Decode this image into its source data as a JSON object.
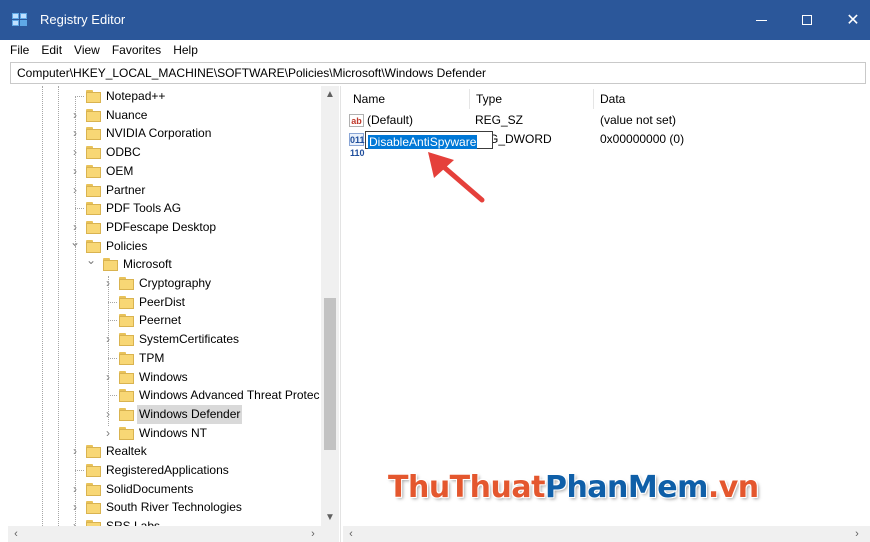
{
  "window": {
    "title": "Registry Editor",
    "colors": {
      "titlebar": "#2b579a",
      "selection": "#0078d7",
      "folder": "#f8d775"
    }
  },
  "menu": [
    "File",
    "Edit",
    "View",
    "Favorites",
    "Help"
  ],
  "address": "Computer\\HKEY_LOCAL_MACHINE\\SOFTWARE\\Policies\\Microsoft\\Windows Defender",
  "tree": [
    {
      "label": "Notepad++",
      "level": 0,
      "chevron": "none"
    },
    {
      "label": "Nuance",
      "level": 0,
      "chevron": "collapsed"
    },
    {
      "label": "NVIDIA Corporation",
      "level": 0,
      "chevron": "collapsed"
    },
    {
      "label": "ODBC",
      "level": 0,
      "chevron": "collapsed"
    },
    {
      "label": "OEM",
      "level": 0,
      "chevron": "collapsed"
    },
    {
      "label": "Partner",
      "level": 0,
      "chevron": "collapsed"
    },
    {
      "label": "PDF Tools AG",
      "level": 0,
      "chevron": "none"
    },
    {
      "label": "PDFescape Desktop",
      "level": 0,
      "chevron": "collapsed"
    },
    {
      "label": "Policies",
      "level": 0,
      "chevron": "expanded"
    },
    {
      "label": "Microsoft",
      "level": 1,
      "chevron": "expanded"
    },
    {
      "label": "Cryptography",
      "level": 2,
      "chevron": "collapsed"
    },
    {
      "label": "PeerDist",
      "level": 2,
      "chevron": "none"
    },
    {
      "label": "Peernet",
      "level": 2,
      "chevron": "none"
    },
    {
      "label": "SystemCertificates",
      "level": 2,
      "chevron": "collapsed"
    },
    {
      "label": "TPM",
      "level": 2,
      "chevron": "none"
    },
    {
      "label": "Windows",
      "level": 2,
      "chevron": "collapsed"
    },
    {
      "label": "Windows Advanced Threat Protec",
      "level": 2,
      "chevron": "none"
    },
    {
      "label": "Windows Defender",
      "level": 2,
      "chevron": "collapsed",
      "selected": true
    },
    {
      "label": "Windows NT",
      "level": 2,
      "chevron": "collapsed"
    },
    {
      "label": "Realtek",
      "level": 0,
      "chevron": "collapsed"
    },
    {
      "label": "RegisteredApplications",
      "level": 0,
      "chevron": "none"
    },
    {
      "label": "SolidDocuments",
      "level": 0,
      "chevron": "collapsed"
    },
    {
      "label": "South River Technologies",
      "level": 0,
      "chevron": "collapsed"
    },
    {
      "label": "SRS Labs",
      "level": 0,
      "chevron": "collapsed"
    }
  ],
  "columns": {
    "name": "Name",
    "type": "Type",
    "data": "Data"
  },
  "values": [
    {
      "icon": "string-value-icon",
      "name": "(Default)",
      "type": "REG_SZ",
      "data": "(value not set)"
    },
    {
      "icon": "dword-value-icon",
      "name": "DisableAntiSpyware",
      "type": "G_DWORD",
      "data": "0x00000000 (0)",
      "editing": true
    }
  ],
  "watermark": {
    "part1": "ThuThuat",
    "part2": "PhanMem",
    "part3": ".vn"
  }
}
